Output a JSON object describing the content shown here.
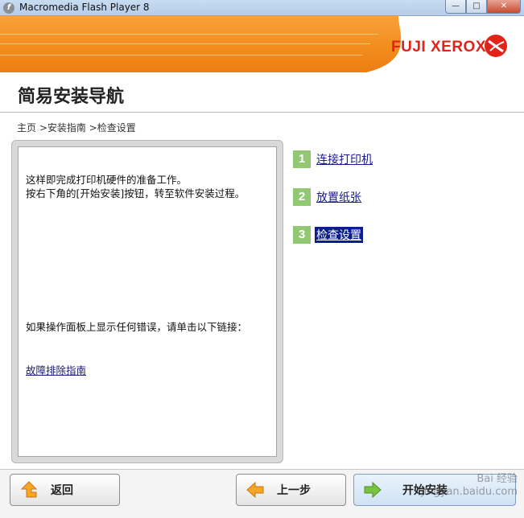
{
  "window": {
    "title": "Macromedia Flash Player 8",
    "icon": "flash-icon",
    "controls": [
      "minimize-icon",
      "maximize-icon",
      "close-icon"
    ]
  },
  "banner": {
    "brand": "FUJI XEROX",
    "colors": {
      "orange": "#f28d1e",
      "brand_red": "#e2231a"
    }
  },
  "page": {
    "title": "简易安装导航",
    "breadcrumb": "主页 >安装指南 >检查设置"
  },
  "panel": {
    "line1": "这样即完成打印机硬件的准备工作。",
    "line2": "按右下角的[开始安装]按钮，转至软件安装过程。",
    "error_text": "如果操作面板上显示任何错误，请单击以下链接：",
    "troubleshoot_link": "故障排除指南"
  },
  "steps": [
    {
      "num": "1",
      "label": "连接打印机"
    },
    {
      "num": "2",
      "label": "放置纸张"
    },
    {
      "num": "3",
      "label": "检查设置",
      "active": true
    }
  ],
  "footer": {
    "back_label": "返回",
    "prev_label": "上一步",
    "start_label": "开始安装",
    "watermark_line1": "Bai 经验",
    "watermark_line2": "jingyan.baidu.com"
  }
}
